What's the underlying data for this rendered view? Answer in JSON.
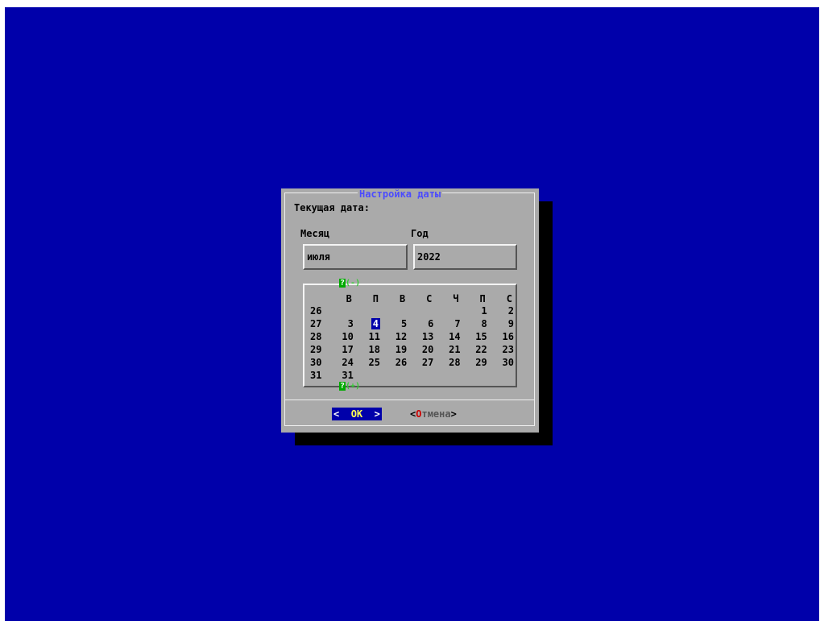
{
  "dialog": {
    "title": "Настройка даты",
    "current_label": "Текущая дата:",
    "month_label": "Месяц",
    "year_label": "Год",
    "month_value": "июля",
    "year_value": "2022"
  },
  "calendar": {
    "scroll_up": "(-)",
    "scroll_down": "(+)",
    "scroll_q": "?",
    "headers": [
      "В",
      "П",
      "В",
      "С",
      "Ч",
      "П",
      "С"
    ],
    "rows": [
      {
        "week": "26",
        "days": [
          "",
          "",
          "",
          "",
          "",
          "1",
          "2"
        ]
      },
      {
        "week": "27",
        "days": [
          "3",
          "4",
          "5",
          "6",
          "7",
          "8",
          "9"
        ]
      },
      {
        "week": "28",
        "days": [
          "10",
          "11",
          "12",
          "13",
          "14",
          "15",
          "16"
        ]
      },
      {
        "week": "29",
        "days": [
          "17",
          "18",
          "19",
          "20",
          "21",
          "22",
          "23"
        ]
      },
      {
        "week": "30",
        "days": [
          "24",
          "25",
          "26",
          "27",
          "28",
          "29",
          "30"
        ]
      },
      {
        "week": "31",
        "days": [
          "31",
          "",
          "",
          "",
          "",
          "",
          ""
        ]
      }
    ],
    "selected_day": "4"
  },
  "buttons": {
    "ok_left": "<",
    "ok_label": "OK",
    "ok_right": ">",
    "cancel_left": "<",
    "cancel_hot": "О",
    "cancel_rest": "тмена",
    "cancel_right": ">"
  },
  "colors": {
    "screen_bg": "#0000aa",
    "dialog_bg": "#aaaaaa",
    "title_color": "#4b4bff",
    "selected_bg": "#0000aa"
  }
}
